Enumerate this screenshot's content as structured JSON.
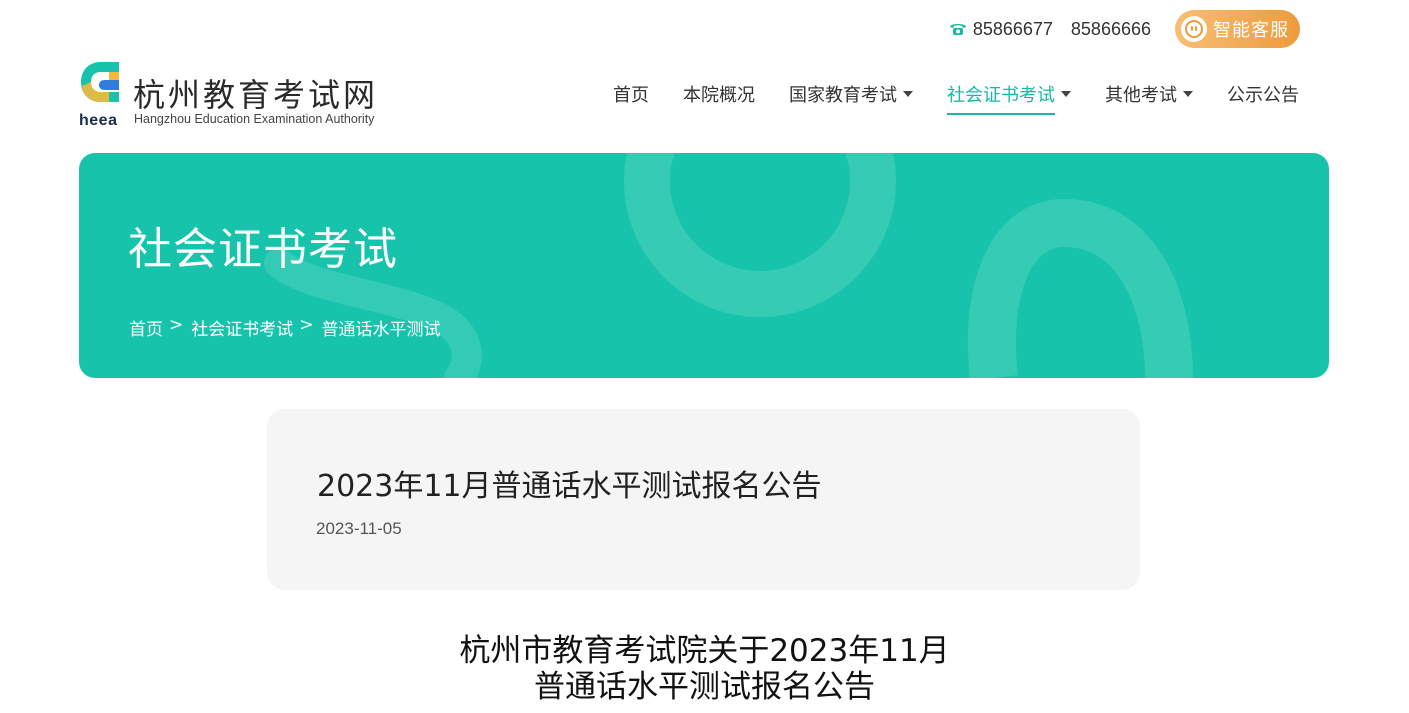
{
  "top": {
    "phone_icon": "phone-icon",
    "phones": [
      "85866677",
      "85866666"
    ],
    "service_label": "智能客服",
    "service_icon": "robot-icon"
  },
  "logo": {
    "cn": "杭州教育考试网",
    "en": "Hangzhou Education Examination Authority",
    "abbr": "heea"
  },
  "nav": {
    "items": [
      {
        "label": "首页",
        "dropdown": false,
        "active": false
      },
      {
        "label": "本院概况",
        "dropdown": false,
        "active": false
      },
      {
        "label": "国家教育考试",
        "dropdown": true,
        "active": false
      },
      {
        "label": "社会证书考试",
        "dropdown": true,
        "active": true
      },
      {
        "label": "其他考试",
        "dropdown": true,
        "active": false
      },
      {
        "label": "公示公告",
        "dropdown": false,
        "active": false
      }
    ]
  },
  "banner": {
    "title": "社会证书考试",
    "breadcrumb": [
      "首页",
      "社会证书考试",
      "普通话水平测试"
    ],
    "separator": ">"
  },
  "article": {
    "title": "2023年11月普通话水平测试报名公告",
    "date": "2023-11-05",
    "heading_line1": "杭州市教育考试院关于2023年11月",
    "heading_line2": "普通话水平测试报名公告"
  },
  "colors": {
    "accent": "#17c4ab",
    "nav_active": "#17b9a4",
    "service_gradient_start": "#f7bf72",
    "service_gradient_end": "#ee9a3d",
    "card_bg": "#f5f5f5"
  }
}
